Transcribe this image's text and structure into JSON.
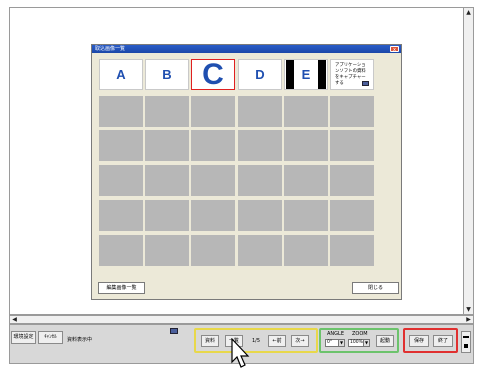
{
  "dialog": {
    "title": "取込画像一覧",
    "close_label": "x",
    "thumbnails": [
      {
        "letter": "A"
      },
      {
        "letter": "B"
      },
      {
        "letter": "C"
      },
      {
        "letter": "D"
      },
      {
        "letter": "E"
      },
      {
        "note": "アプリケーションソフトの資料をキャプチャーする"
      }
    ],
    "edit_button": "編集画像一覧",
    "close_button": "閉じる"
  },
  "bottom": {
    "settings_button": "環境設定",
    "cancel_button": "ｷｬﾝｾﾙ",
    "status_text": "資料表示中",
    "material_button": "資料",
    "list_button": "一覧",
    "page_indicator": "1/5",
    "prev_button": "←前",
    "next_button": "次→",
    "angle_label": "ANGLE",
    "zoom_label": "ZOOM",
    "angle_value": "0°",
    "zoom_value": "100%",
    "start_button": "起動",
    "save_button": "保存",
    "exit_button": "終了"
  },
  "colors": {
    "material_group": "#e8d84a",
    "angle_zoom_group": "#6cc36c",
    "save_exit_group": "#e03030",
    "thumbnail_letter": "#1f4fb0"
  }
}
